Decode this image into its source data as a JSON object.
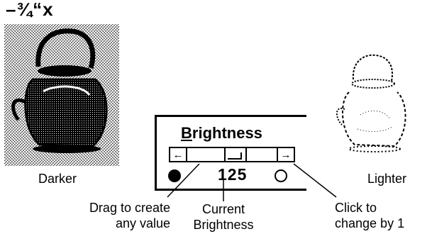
{
  "header": {
    "glyphs": "–¾“x"
  },
  "images": {
    "darker_caption": "Darker",
    "lighter_caption": "Lighter"
  },
  "brightness_control": {
    "title_underlined": "B",
    "title_rest": "rightness",
    "left_arrow": "←",
    "right_arrow": "→",
    "value": "125"
  },
  "callouts": {
    "drag_line1": "Drag to create",
    "drag_line2": "any value",
    "current_line1": "Current",
    "current_line2": "Brightness",
    "click_line1": "Click to",
    "click_line2": "change by 1"
  },
  "icons": {
    "darker_image": "kettle-darker-image",
    "lighter_image": "kettle-lighter-image",
    "dark_dot": "filled-circle-icon",
    "light_dot": "hollow-circle-icon"
  }
}
